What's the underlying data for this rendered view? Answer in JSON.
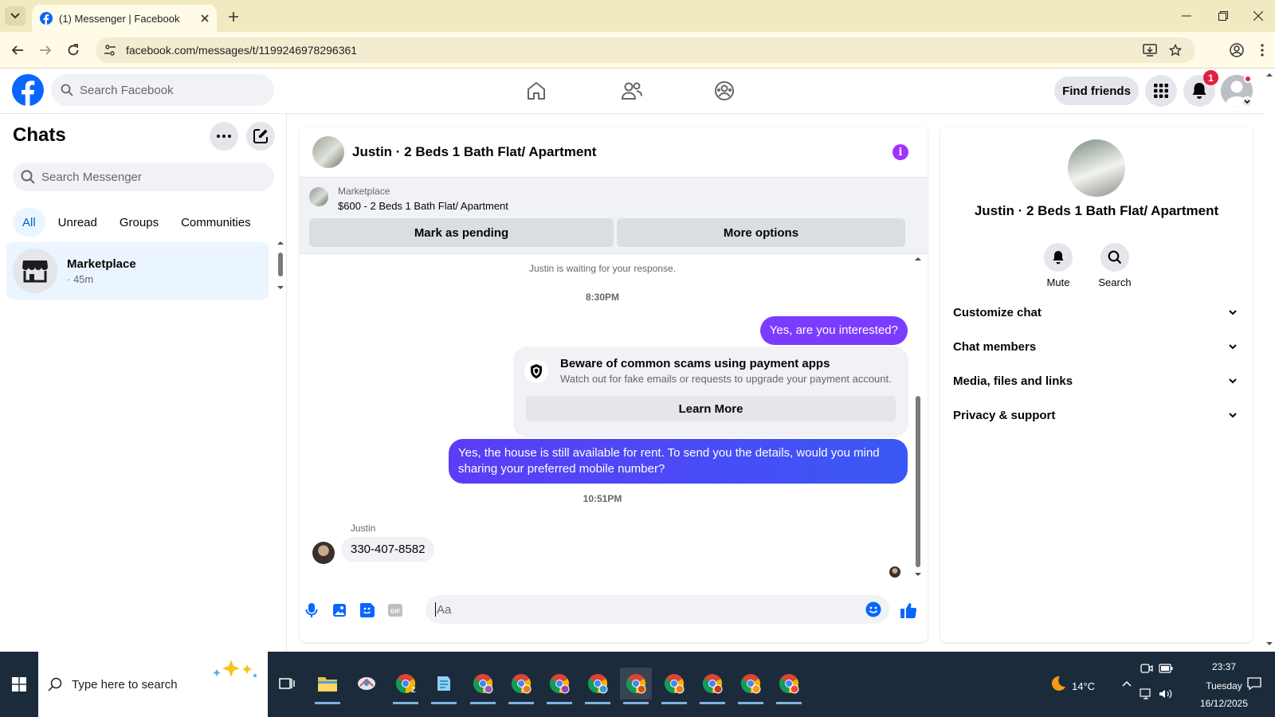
{
  "browser": {
    "tab_title": "(1) Messenger | Facebook",
    "url": "facebook.com/messages/t/1199246978296361"
  },
  "fb_header": {
    "search_placeholder": "Search Facebook",
    "find_friends_label": "Find friends",
    "notification_count": "1"
  },
  "chats": {
    "title": "Chats",
    "search_placeholder": "Search Messenger",
    "filters": [
      "All",
      "Unread",
      "Groups",
      "Communities"
    ],
    "active_filter": "All",
    "items": [
      {
        "name": "Marketplace",
        "meta": "· 45m"
      }
    ]
  },
  "conversation": {
    "title": "Justin · 2 Beds 1 Bath Flat/ Apartment",
    "marketplace": {
      "label": "Marketplace",
      "listing": "$600 - 2 Beds 1 Bath Flat/ Apartment",
      "mark_pending_label": "Mark as pending",
      "more_options_label": "More options"
    },
    "waiting_text": "Justin is waiting for your response.",
    "timestamp_1": "8:30PM",
    "msg_out_1": "Yes, are you interested?",
    "scam_warning": {
      "title": "Beware of common scams using payment apps",
      "text": "Watch out for fake emails or requests to upgrade your payment account.",
      "button_label": "Learn More"
    },
    "msg_out_2": "Yes, the house is still available for rent. To send you the details, would you mind sharing your preferred mobile number?",
    "timestamp_2": "10:51PM",
    "incoming_sender": "Justin",
    "msg_in_1": "330-407-8582",
    "composer_placeholder": "Aa",
    "accent_color": "#a033ff"
  },
  "info_panel": {
    "name": "Justin · 2 Beds 1 Bath Flat/ Apartment",
    "actions": [
      {
        "label": "Mute",
        "icon": "bell-icon"
      },
      {
        "label": "Search",
        "icon": "search-icon"
      }
    ],
    "sections": [
      "Customize chat",
      "Chat members",
      "Media, files and links",
      "Privacy & support"
    ]
  },
  "taskbar": {
    "search_placeholder": "Type here to search",
    "weather": "14°C",
    "time": "23:37",
    "day": "Tuesday",
    "date": "16/12/2025"
  }
}
